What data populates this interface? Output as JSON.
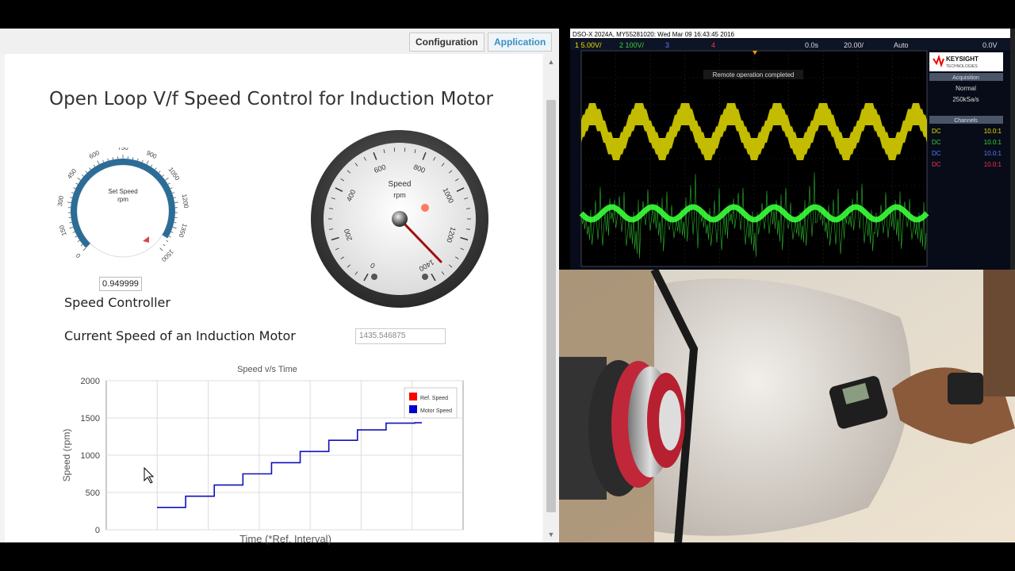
{
  "tabs": {
    "configuration": "Configuration",
    "application": "Application"
  },
  "app": {
    "title": "Open Loop V/f Speed Control for Induction Motor",
    "knob": {
      "title": "Set Speed",
      "unit": "rpm",
      "ticks": [
        "0",
        "150",
        "300",
        "450",
        "600",
        "750",
        "900",
        "1050",
        "1200",
        "1350",
        "1500"
      ],
      "value": "0.949999"
    },
    "gauge": {
      "title": "Speed",
      "unit": "rpm",
      "ticks": [
        "0",
        "200",
        "400",
        "600",
        "800",
        "1000",
        "1200",
        "1400"
      ]
    },
    "speed_controller_label": "Speed Controller",
    "current_speed_label": "Current Speed of an Induction Motor",
    "current_speed_value": "1435.546875"
  },
  "chart_data": {
    "type": "line",
    "title": "Speed v/s Time",
    "xlabel": "Time (*Ref. Interval)",
    "ylabel": "Speed (rpm)",
    "ylim": [
      0,
      2000
    ],
    "yticks": [
      "0",
      "500",
      "1000",
      "1500",
      "2000"
    ],
    "grid": true,
    "legend_position": "top-right",
    "series": [
      {
        "name": "Ref. Speed",
        "color": "#ff0000",
        "values": []
      },
      {
        "name": "Motor Speed",
        "color": "#0000cc",
        "x": [
          1,
          2,
          3,
          4,
          5,
          6,
          7,
          8,
          9,
          10
        ],
        "values": [
          300,
          450,
          600,
          750,
          900,
          1050,
          1200,
          1340,
          1430,
          1435
        ]
      }
    ]
  },
  "scope": {
    "header": "DSO-X 2024A, MY55281020: Wed Mar 09 16:43:45 2016",
    "ch_settings": [
      "1  5.00V/",
      "2  100V/",
      "3",
      "4"
    ],
    "time": "0.0s",
    "timebase": "20.00/",
    "mode": "Auto",
    "trigger": "0.0V",
    "status": "Remote operation completed",
    "brand": "KEYSIGHT",
    "brand_sub": "TECHNOLOGIES",
    "acquisition_label": "Acquisition",
    "acquisition_mode": "Normal",
    "acquisition_rate": "250kSa/s",
    "channels_label": "Channels",
    "channels": [
      {
        "coupling": "DC",
        "ratio": "10.0:1",
        "color": "#e8e000"
      },
      {
        "coupling": "DC",
        "ratio": "10.0:1",
        "color": "#3ad13a"
      },
      {
        "coupling": "DC",
        "ratio": "10.0:1",
        "color": "#5a7aff"
      },
      {
        "coupling": "DC",
        "ratio": "10.0:1",
        "color": "#ff3050"
      }
    ]
  }
}
